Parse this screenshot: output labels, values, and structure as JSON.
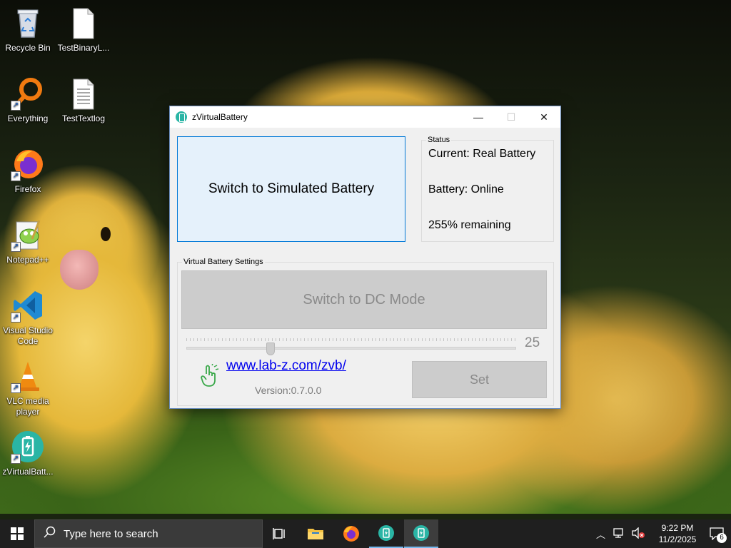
{
  "desktop": {
    "icons": [
      {
        "label": "Recycle Bin",
        "icon": "recycle-bin-icon"
      },
      {
        "label": "TestBinaryL...",
        "icon": "blank-file-icon"
      },
      {
        "label": "Everything",
        "icon": "everything-search-icon"
      },
      {
        "label": "TestTextlog",
        "icon": "text-file-icon"
      },
      {
        "label": "Firefox",
        "icon": "firefox-icon"
      },
      {
        "label": "Notepad++",
        "icon": "notepadpp-icon"
      },
      {
        "label": "Visual Studio Code",
        "icon": "vscode-icon"
      },
      {
        "label": "VLC media player",
        "icon": "vlc-icon"
      },
      {
        "label": "zVirtualBatt...",
        "icon": "zvirtualbattery-icon"
      }
    ]
  },
  "window": {
    "title": "zVirtualBattery",
    "controls": {
      "minimize": "—",
      "maximize": "☐",
      "close": "✕"
    },
    "switch_button": "Switch to Simulated Battery",
    "status": {
      "legend": "Status",
      "current": "Current: Real Battery",
      "battery": "Battery: Online",
      "remaining": "255% remaining"
    },
    "virtual_battery": {
      "legend": "Virtual Battery Settings",
      "dc_mode_button": "Switch to DC Mode",
      "slider_value": "25",
      "link": "www.lab-z.com/zvb/",
      "version": "Version:0.7.0.0",
      "set_button": "Set"
    }
  },
  "taskbar": {
    "search_placeholder": "Type here to search",
    "time": "9:22 PM",
    "date": "11/2/2025",
    "notification_count": "6",
    "items": [
      "task-view-icon",
      "file-explorer-icon",
      "firefox-icon",
      "zvirtualbattery-icon",
      "zvirtualbattery-icon"
    ]
  }
}
